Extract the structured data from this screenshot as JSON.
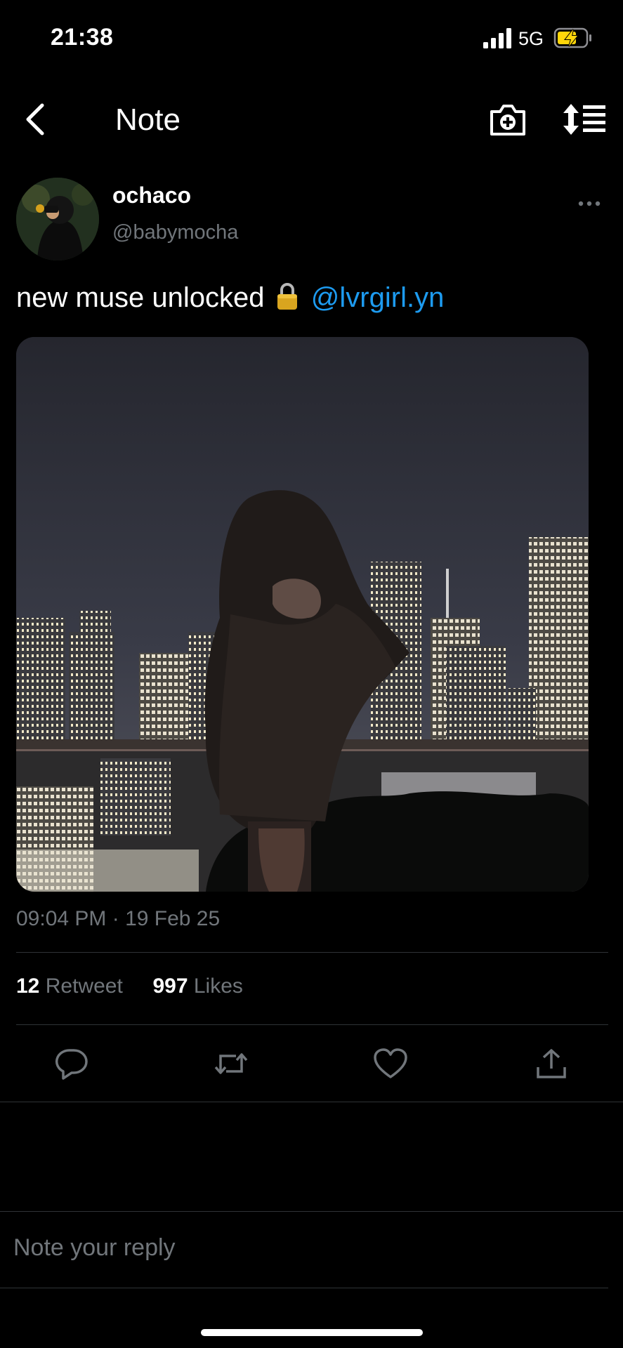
{
  "status_bar": {
    "time": "21:38",
    "network": "5G"
  },
  "header": {
    "title": "Note"
  },
  "author": {
    "name": "ochaco",
    "handle": "@babymocha"
  },
  "post": {
    "text": "new muse unlocked",
    "emoji": "lock",
    "mention": "@lvrgirl.yn"
  },
  "meta": {
    "timestamp": "09:04 PM · 19 Feb 25"
  },
  "stats": {
    "retweet_count": "12",
    "retweet_label": "Retweet",
    "likes_count": "997",
    "likes_label": "Likes"
  },
  "reply": {
    "placeholder": "Note your reply"
  },
  "icons": [
    "back-icon",
    "camera-plus-icon",
    "sort-list-icon",
    "more-icon",
    "reply-icon",
    "retweet-icon",
    "like-icon",
    "share-icon"
  ],
  "colors": {
    "accent": "#1d9bf0",
    "muted": "#71767b",
    "divider": "#2f3336",
    "battery": "#ffd60a"
  }
}
